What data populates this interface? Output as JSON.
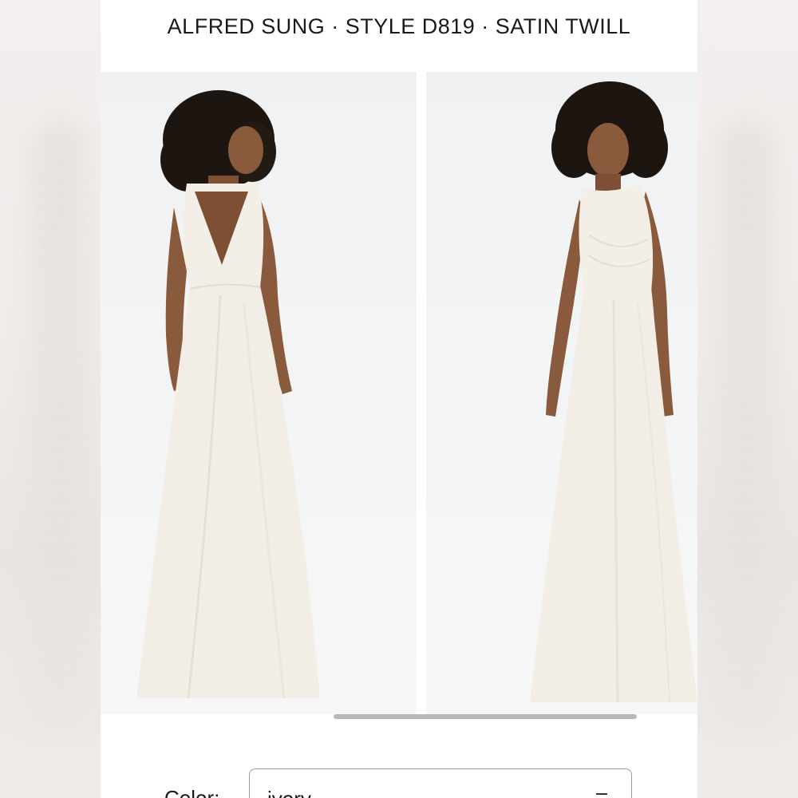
{
  "header": {
    "title": "ALFRED SUNG · STYLE D819 · SATIN TWILL"
  },
  "gallery": {
    "images": [
      {
        "view": "back",
        "alt": "model in ivory satin twill gown, back view"
      },
      {
        "view": "front",
        "alt": "model in ivory satin twill gown, front view"
      }
    ]
  },
  "options": {
    "color_label": "Color:",
    "color_value": "ivory",
    "chevron_icon": "chevron-down-icon"
  },
  "colors": {
    "dress": "#f4efe6",
    "skin": "#8a5a3c",
    "hair": "#1c1510",
    "background": "#f3f4f5"
  }
}
